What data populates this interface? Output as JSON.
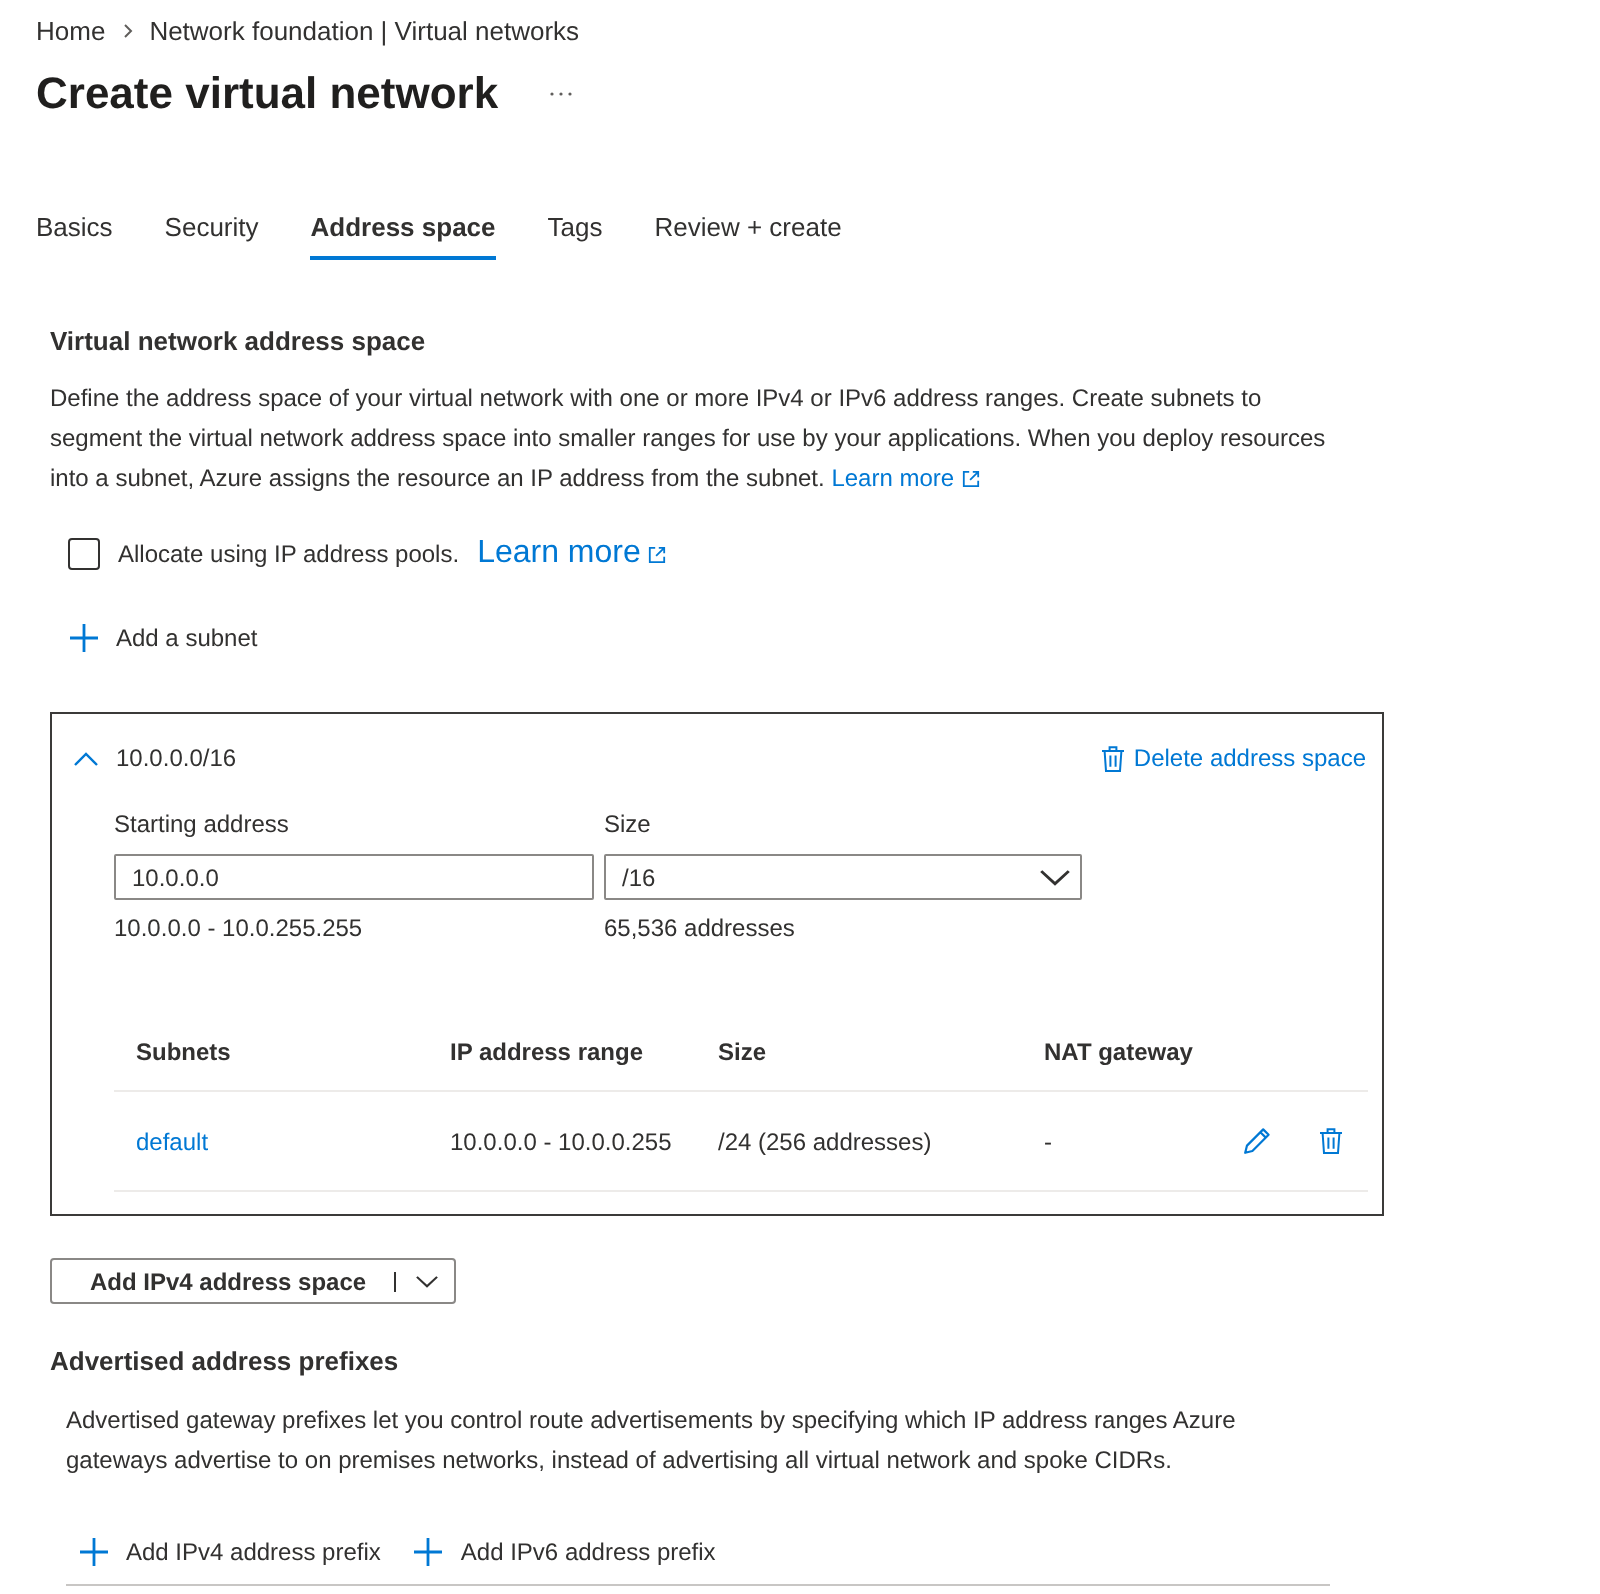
{
  "breadcrumb": [
    {
      "label": "Home"
    },
    {
      "label": "Network foundation | Virtual networks"
    }
  ],
  "title": "Create virtual network",
  "tabs": [
    {
      "label": "Basics",
      "selected": false
    },
    {
      "label": "Security",
      "selected": false
    },
    {
      "label": "Address space",
      "selected": true
    },
    {
      "label": "Tags",
      "selected": false
    },
    {
      "label": "Review + create",
      "selected": false
    }
  ],
  "address_section": {
    "heading": "Virtual network address space",
    "description": "Define the address space of your virtual network with one or more IPv4 or IPv6 address ranges. Create subnets to segment the virtual network address space into smaller ranges for use by your applications. When you deploy resources into a subnet, Azure assigns the resource an IP address from the subnet.",
    "link": "Learn more",
    "pool_option": {
      "label": "Allocate using IP address pools.",
      "link": "Learn more",
      "checked": false
    },
    "add_subnet": "Add a subnet"
  },
  "address_space": {
    "title": "10.0.0.0/16",
    "expanded": true,
    "delete_label": "Delete address space",
    "starting_address": {
      "label": "Starting address",
      "value": "10.0.0.0",
      "hint": "10.0.0.0 - 10.0.255.255"
    },
    "size": {
      "label": "Size",
      "value": "/16",
      "hint": "65,536 addresses"
    },
    "subnets": {
      "columns": [
        "Subnets",
        "IP address range",
        "Size",
        "NAT gateway"
      ],
      "rows": [
        {
          "cells": [
            "default",
            "10.0.0.0 - 10.0.0.255",
            "/24 (256 addresses)",
            "-"
          ]
        }
      ]
    }
  },
  "add_space_button": "Add IPv4 address space",
  "prefix_section": {
    "heading": "Advertised address prefixes",
    "description": "Advertised gateway prefixes let you control route advertisements by specifying which IP address ranges Azure gateways advertise to on premises networks, instead of advertising all virtual network and spoke CIDRs.",
    "actions": [
      "Add IPv4 address prefix",
      "Add IPv6 address prefix"
    ]
  }
}
